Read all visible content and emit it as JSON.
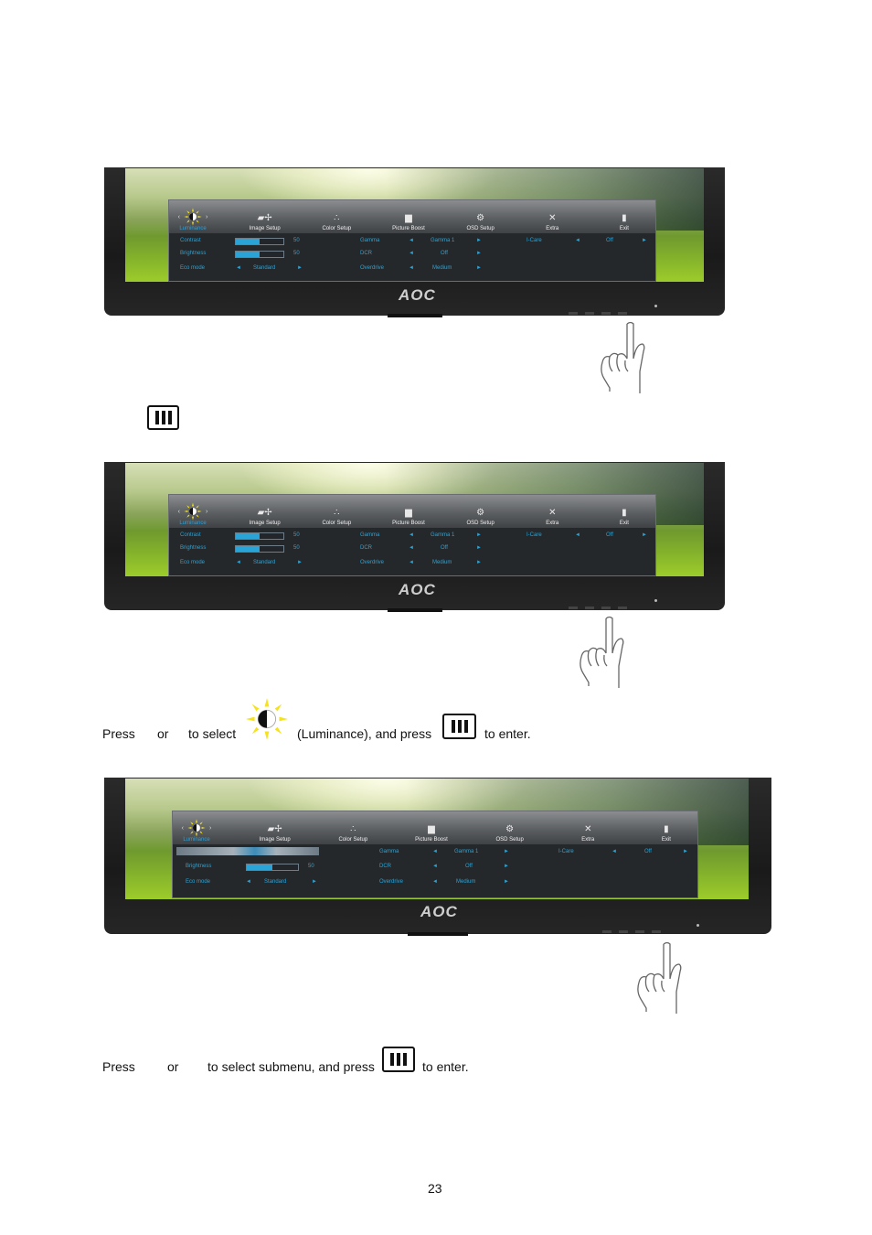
{
  "document": {
    "page_number": "23",
    "menu_key_icon": "menu-key-icon",
    "luminance_icon": "luminance-sun-icon",
    "hand_icon": "pointing-hand-icon"
  },
  "monitor": {
    "brand_logo": "AOC"
  },
  "osd": {
    "tabs": [
      {
        "label": "Luminance",
        "icon": "luminance-sun-icon"
      },
      {
        "label": "Image Setup",
        "icon": "image-setup-icon"
      },
      {
        "label": "Color Setup",
        "icon": "color-setup-icon"
      },
      {
        "label": "Picture Boost",
        "icon": "picture-boost-icon"
      },
      {
        "label": "OSD Setup",
        "icon": "osd-setup-icon"
      },
      {
        "label": "Extra",
        "icon": "extra-tools-icon"
      },
      {
        "label": "Exit",
        "icon": "exit-door-icon"
      }
    ],
    "nav_left": "‹",
    "nav_right": "›",
    "arrow_left": "◄",
    "arrow_right": "►",
    "settings": {
      "contrast": {
        "label": "Contrast",
        "value": "50",
        "level": 0.5
      },
      "brightness": {
        "label": "Brightness",
        "value": "50",
        "level": 0.5
      },
      "eco_mode": {
        "label": "Eco mode",
        "value": "Standard"
      },
      "gamma": {
        "label": "Gamma",
        "value": "Gamma 1"
      },
      "dcr": {
        "label": "DCR",
        "value": "Off"
      },
      "overdrive": {
        "label": "Overdrive",
        "value": "Medium"
      },
      "i_care": {
        "label": "I-Care",
        "value": "Off"
      }
    }
  },
  "instructions": {
    "step3": {
      "press": "Press",
      "or": "or",
      "to_select": "to select",
      "luminance": "(Luminance), and press",
      "to_enter": "to enter."
    },
    "step4": {
      "press": "Press",
      "or": "or",
      "to_select_submenu": "to select submenu, and press",
      "to_enter": "to enter."
    }
  }
}
